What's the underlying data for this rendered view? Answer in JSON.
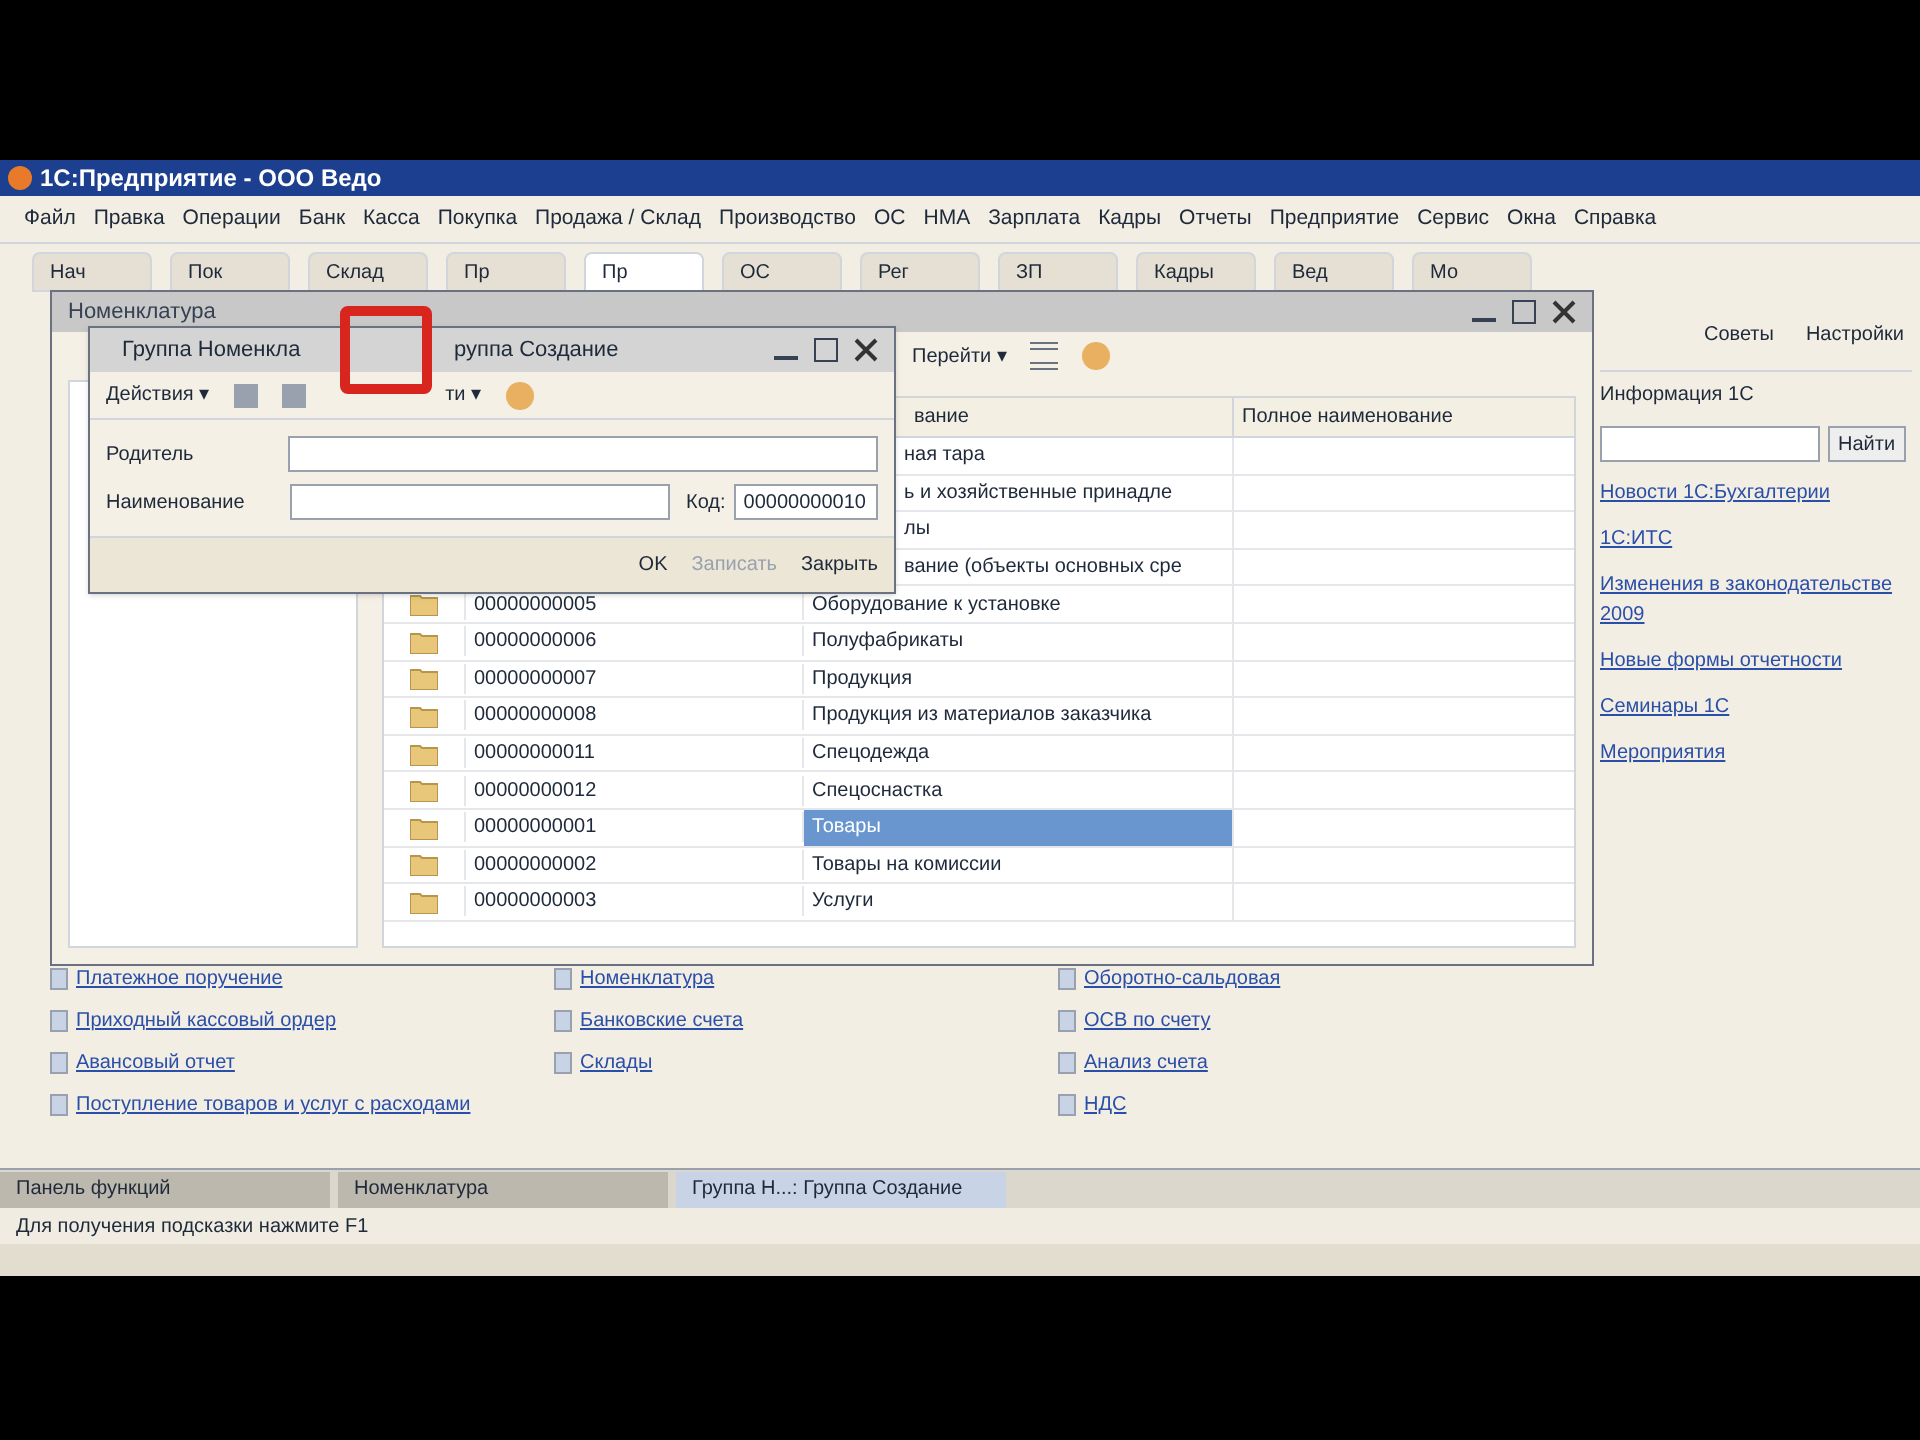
{
  "window": {
    "title": "1С:Предприятие - ООО Ведо"
  },
  "menu": [
    "Файл",
    "Правка",
    "Операции",
    "Банк",
    "Касса",
    "Покупка",
    "Продажа / Склад",
    "Производство",
    "ОС",
    "НМА",
    "Зарплата",
    "Кадры",
    "Отчеты",
    "Предприятие",
    "Сервис",
    "Окна",
    "Справка"
  ],
  "panel_tabs": [
    {
      "label": "Нач",
      "selected": false
    },
    {
      "label": "Пок",
      "selected": false
    },
    {
      "label": "Склад",
      "selected": false
    },
    {
      "label": "Пр",
      "selected": false
    },
    {
      "label": "Пр",
      "selected": true
    },
    {
      "label": "ОС",
      "selected": false
    },
    {
      "label": "Рег",
      "selected": false
    },
    {
      "label": "ЗП",
      "selected": false
    },
    {
      "label": "Кадры",
      "selected": false
    },
    {
      "label": "Вед",
      "selected": false
    },
    {
      "label": "Мо",
      "selected": false
    }
  ],
  "back_window": {
    "title": "Номенклатура",
    "toolbar": [
      "Перейти ▾"
    ],
    "columns": [
      "вание",
      "Полное наименование"
    ],
    "rows": [
      {
        "kind": "covered",
        "code": "",
        "name": "ная тара",
        "selected": false
      },
      {
        "kind": "covered",
        "code": "",
        "name": "ь и хозяйственные принадле",
        "selected": false
      },
      {
        "kind": "covered",
        "code": "",
        "name": "лы",
        "selected": false
      },
      {
        "kind": "covered",
        "code": "",
        "name": "вание (объекты основных сре",
        "selected": false
      },
      {
        "kind": "normal",
        "code": "00000000005",
        "name": "Оборудование к установке",
        "selected": false
      },
      {
        "kind": "normal",
        "code": "00000000006",
        "name": "Полуфабрикаты",
        "selected": false
      },
      {
        "kind": "normal",
        "code": "00000000007",
        "name": "Продукция",
        "selected": false
      },
      {
        "kind": "normal",
        "code": "00000000008",
        "name": "Продукция из материалов заказчика",
        "selected": false
      },
      {
        "kind": "normal",
        "code": "00000000011",
        "name": "Спецодежда",
        "selected": false
      },
      {
        "kind": "normal",
        "code": "00000000012",
        "name": "Спецоснастка",
        "selected": false
      },
      {
        "kind": "normal",
        "code": "00000000001",
        "name": "Товары",
        "selected": true
      },
      {
        "kind": "normal",
        "code": "00000000002",
        "name": "Товары на комиссии",
        "selected": false
      },
      {
        "kind": "normal",
        "code": "00000000003",
        "name": "Услуги",
        "selected": false
      }
    ]
  },
  "dialog": {
    "title_left": "Группа Номенкла",
    "title_right": "руппа Создание",
    "toolbar": [
      "Действия ▾",
      "ти ▾"
    ],
    "fields": [
      {
        "label": "Родитель"
      },
      {
        "label": "Наименование"
      }
    ],
    "code_label": "Код:",
    "code_value": "00000000010",
    "buttons": [
      {
        "label": "OK",
        "disabled": false
      },
      {
        "label": "Записать",
        "disabled": true
      },
      {
        "label": "Закрыть",
        "disabled": false
      }
    ]
  },
  "side": {
    "buttons": [
      "Советы",
      "Настройки"
    ],
    "heading": "Информация 1С",
    "search_button": "Найти",
    "links": [
      "Новости 1С:Бухгалтерии",
      "1С:ИТС",
      "Изменения в законодательстве 2009",
      "Новые формы отчетности",
      "Семинары 1С",
      "Мероприятия"
    ]
  },
  "desktop_links": [
    [
      "Платежное поручение",
      "Приходный кассовый ордер",
      "Авансовый отчет",
      "Поступление товаров и услуг с расходами"
    ],
    [
      "Номенклатура",
      "Банковские счета",
      "Склады"
    ],
    [
      "Оборотно-сальдовая",
      "ОСВ по счету",
      "Анализ счета",
      "НДС"
    ]
  ],
  "taskbar": [
    {
      "label": "Панель функций",
      "selected": false
    },
    {
      "label": "Номенклатура",
      "selected": false
    },
    {
      "label": "Группа Н...: Группа Создание",
      "selected": true
    }
  ],
  "status_bar": "Для получения подсказки нажмите F1"
}
